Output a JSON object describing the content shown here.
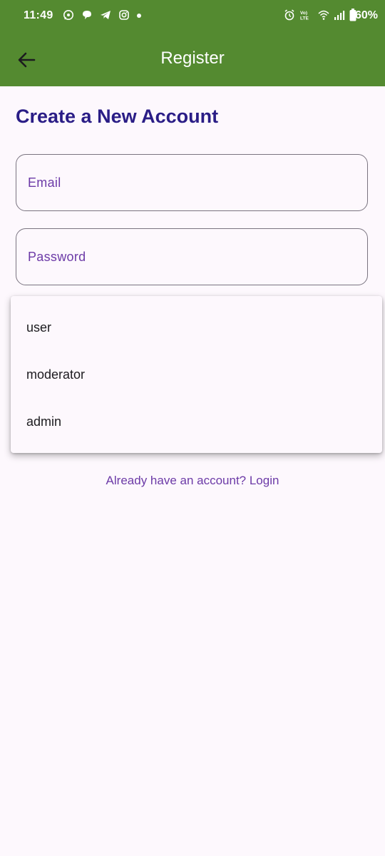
{
  "status_bar": {
    "time": "11:49",
    "battery": "60%",
    "left_icons": [
      "whatsapp-icon",
      "chat-bubble-icon",
      "telegram-icon",
      "instagram-icon",
      "notification-dot-icon"
    ],
    "right_icons": [
      "alarm-icon",
      "volte-icon",
      "wifi-icon",
      "signal-icon",
      "battery-icon"
    ],
    "color": "#548a30"
  },
  "app_bar": {
    "title": "Register",
    "back_icon": "arrow-back-icon",
    "background": "#548a30"
  },
  "form": {
    "heading": "Create a New Account",
    "email_label": "Email",
    "password_label": "Password"
  },
  "role_menu": {
    "options": [
      "user",
      "moderator",
      "admin"
    ]
  },
  "footer": {
    "login_link": "Already have an account? Login"
  },
  "colors": {
    "heading": "#2a1d86",
    "accent": "#6c3aa7",
    "background": "#fdf8fd"
  }
}
